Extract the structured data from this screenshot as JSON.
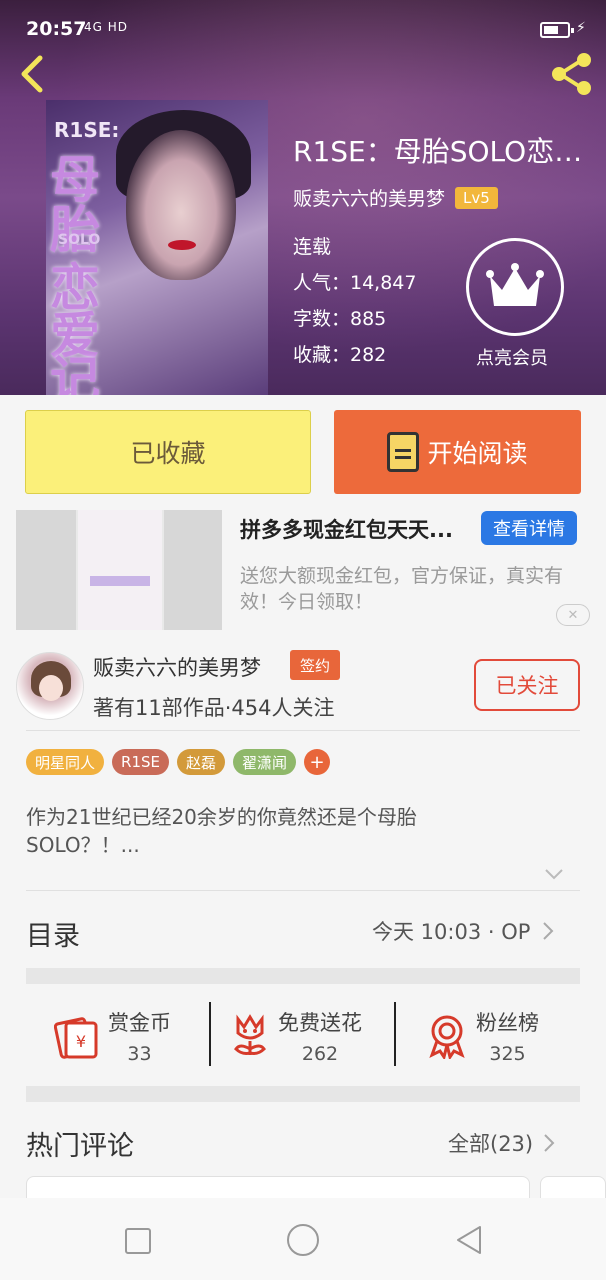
{
  "status_bar": {
    "time": "20:57",
    "signal": "4G HD"
  },
  "book": {
    "title": "R1SE：母胎SOLO恋爱...",
    "author": "贩卖六六的美男梦",
    "level": "Lv5",
    "state": "连载",
    "popularity": "人气：14,847",
    "words": "字数：885",
    "favorites": "收藏：282",
    "cover_text": {
      "top": "R1SE:",
      "c1": "母",
      "c2": "胎",
      "solo": "SOLO",
      "c3": "恋",
      "c4": "爱",
      "c5": "记"
    },
    "vip_label": "点亮会员"
  },
  "actions": {
    "favorited": "已收藏",
    "read": "开始阅读"
  },
  "ad": {
    "title": "拼多多现金红包天天...",
    "button": "查看详情",
    "description": "送您大额现金红包，官方保证，真实有效！今日领取！",
    "close": "✕"
  },
  "author": {
    "name": "贩卖六六的美男梦",
    "badge": "签约",
    "stats": "著有11部作品·454人关注",
    "follow": "已关注"
  },
  "tags": [
    {
      "label": "明星同人",
      "color": "#f1b13f"
    },
    {
      "label": "R1SE",
      "color": "#c96b58"
    },
    {
      "label": "赵磊",
      "color": "#d39a3a"
    },
    {
      "label": "翟潇闻",
      "color": "#8fb86a"
    }
  ],
  "tag_add": "+",
  "intro": "作为21世纪已经20余岁的你竟然还是个母胎SOLO？！...",
  "toc": {
    "title": "目录",
    "latest": "今天 10:03 · OP"
  },
  "stats": [
    {
      "label": "赏金币",
      "value": "33"
    },
    {
      "label": "免费送花",
      "value": "262"
    },
    {
      "label": "粉丝榜",
      "value": "325"
    }
  ],
  "hot_comments": {
    "title": "热门评论",
    "all": "全部(23)"
  },
  "colors": {
    "accent": "#ed6a3b",
    "fav_yellow": "#fbf07a",
    "ad_blue": "#2b78e4",
    "icon_red": "#d63a2a"
  }
}
